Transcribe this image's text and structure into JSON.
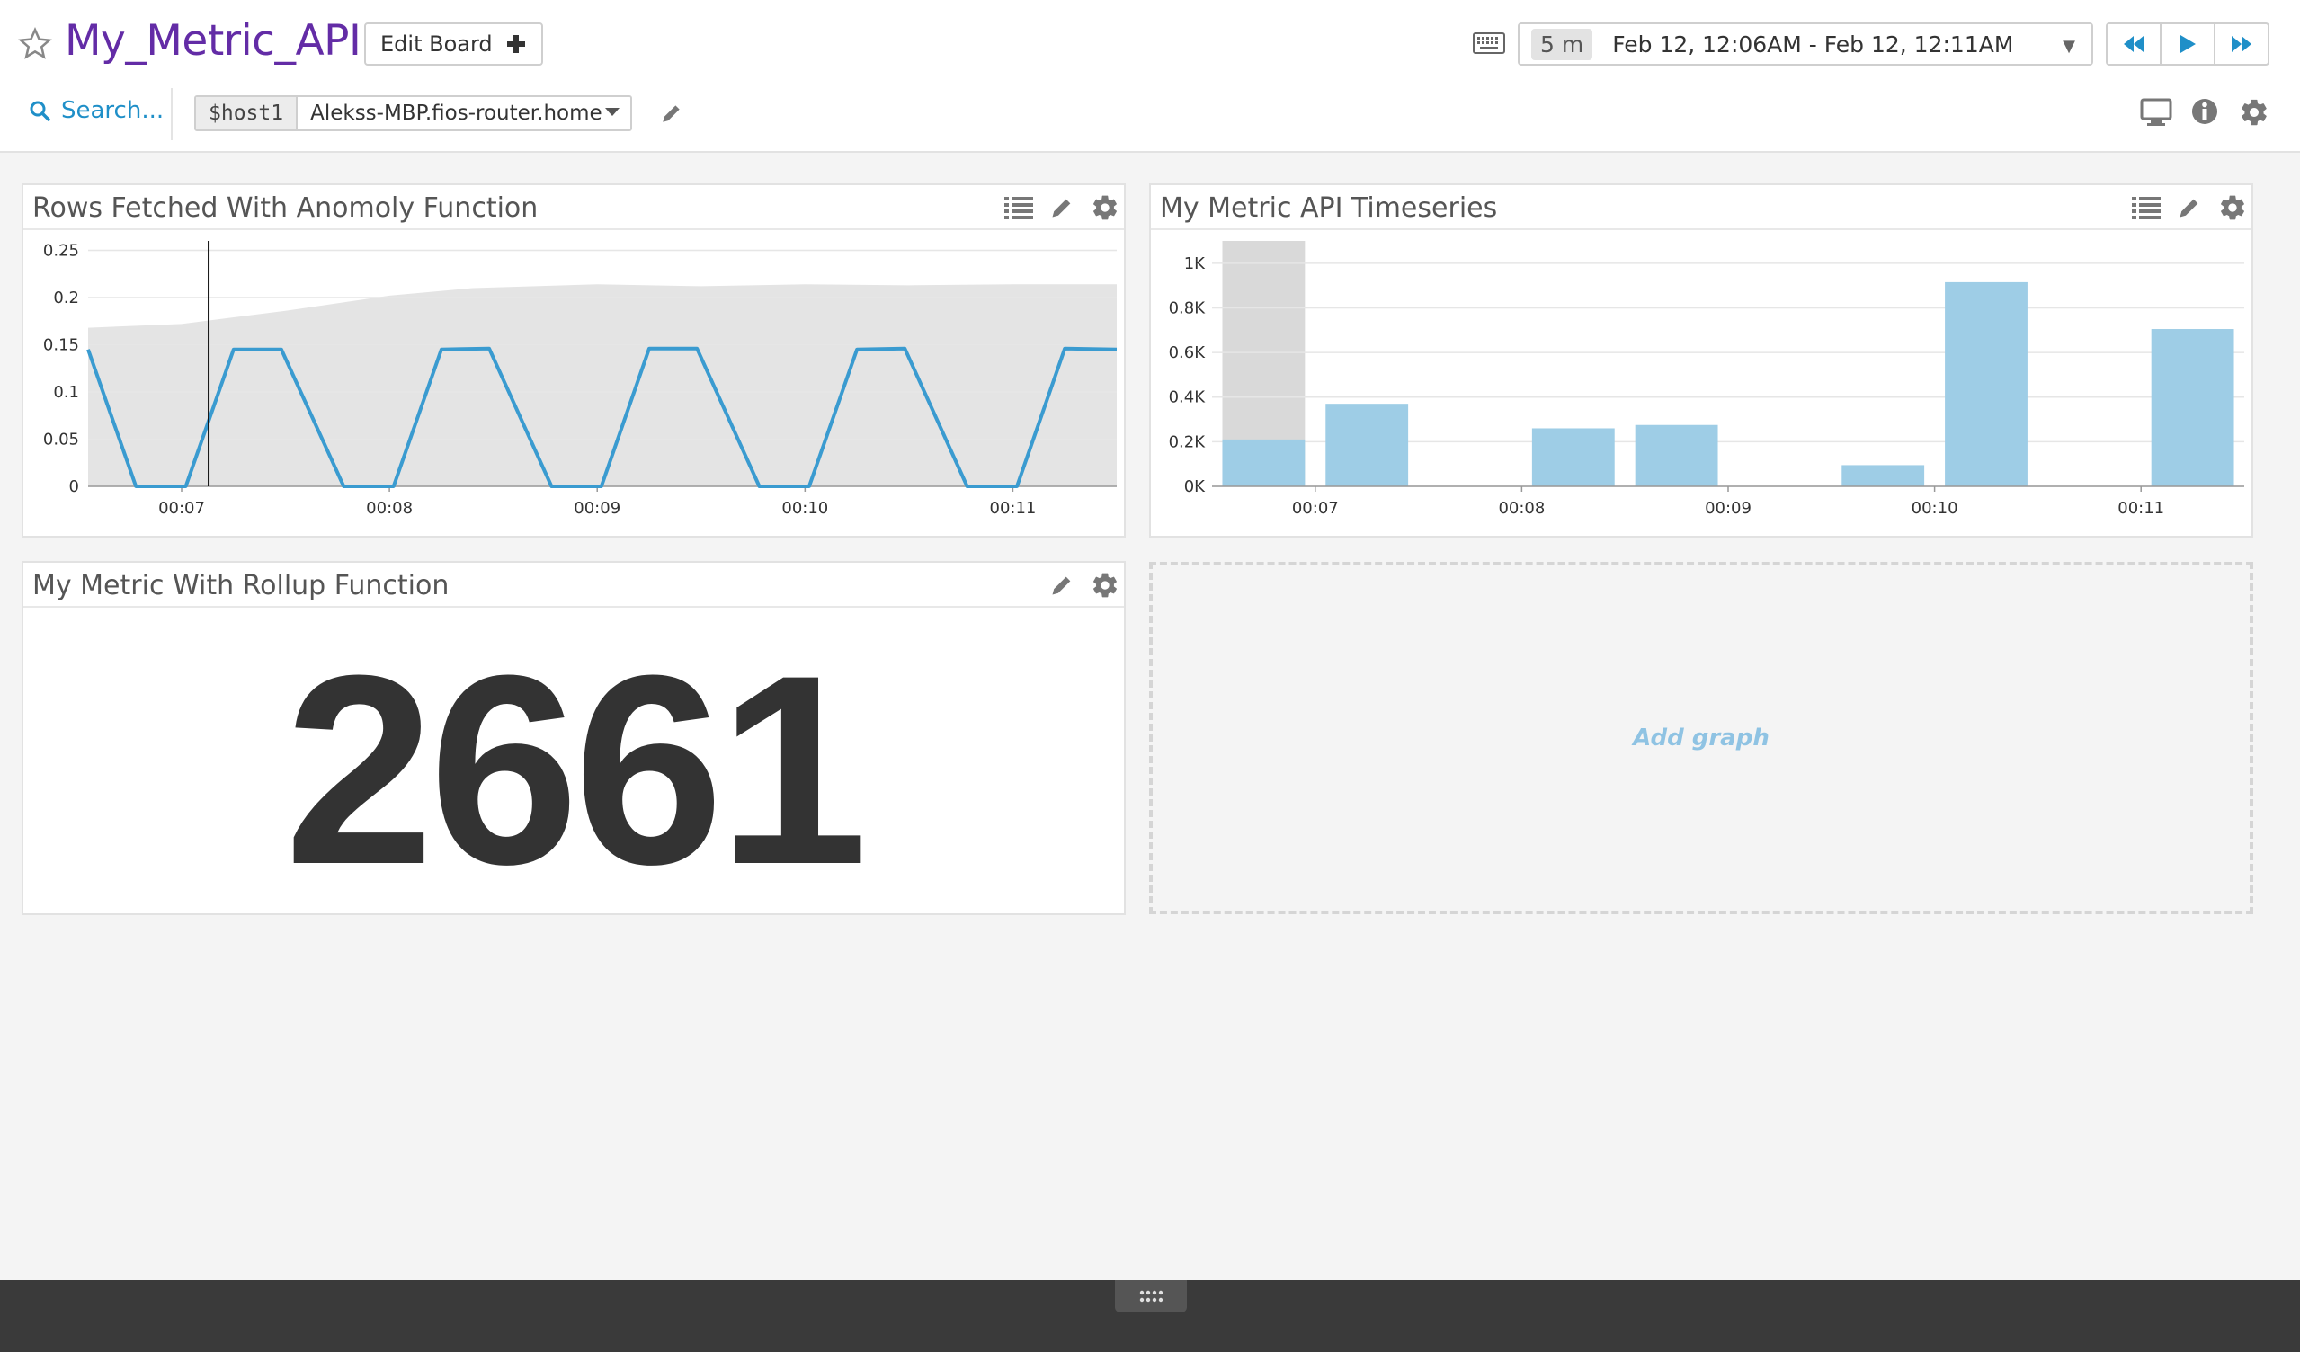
{
  "header": {
    "title": "My_Metric_API",
    "edit_board_label": "Edit Board",
    "time_chip": "5 m",
    "time_range": "Feb 12, 12:06AM - Feb 12, 12:11AM"
  },
  "toolbar": {
    "search_label": "Search...",
    "template_var_name": "$host1",
    "template_var_value": "Alekss-MBP.fios-router.home"
  },
  "widgets": {
    "anomaly": {
      "title": "Rows Fetched With Anomoly Function"
    },
    "timeseries": {
      "title": "My Metric API Timeseries"
    },
    "rollup": {
      "title": "My Metric With Rollup Function",
      "value": "2661"
    },
    "add_graph_label": "Add graph"
  },
  "colors": {
    "accent": "#632ca6",
    "link": "#1f8fc8",
    "line_series": "#3a9bd0",
    "bar_series": "#9ecde6",
    "anomaly_band": "#e4e4e4"
  },
  "chart_data": [
    {
      "type": "line",
      "title": "Rows Fetched With Anomoly Function",
      "x_ticks": [
        "00:07",
        "00:08",
        "00:09",
        "00:10",
        "00:11"
      ],
      "y_ticks": [
        "0",
        "0.05",
        "0.1",
        "0.15",
        "0.2",
        "0.25"
      ],
      "ylim": [
        0,
        0.26
      ],
      "x_domain_minutes": [
        6.55,
        11.5
      ],
      "series": [
        {
          "x": [
            6.55,
            6.78,
            7.02,
            7.25,
            7.48,
            7.78,
            8.02,
            8.25,
            8.48,
            8.78,
            9.02,
            9.25,
            9.48,
            9.78,
            10.02,
            10.25,
            10.48,
            10.78,
            11.02,
            11.25,
            11.5
          ],
          "values": [
            0.145,
            0,
            0,
            0.145,
            0.145,
            0,
            0,
            0.145,
            0.146,
            0,
            0,
            0.146,
            0.146,
            0,
            0,
            0.145,
            0.146,
            0,
            0,
            0.146,
            0.145
          ]
        }
      ],
      "anomaly_band": {
        "x": [
          6.55,
          7.0,
          7.5,
          8.0,
          8.4,
          9.0,
          9.5,
          10.0,
          10.5,
          11.0,
          11.5
        ],
        "upper": [
          0.168,
          0.172,
          0.186,
          0.202,
          0.21,
          0.214,
          0.212,
          0.214,
          0.213,
          0.214,
          0.214
        ]
      },
      "cursor_x": 7.13,
      "grid": true
    },
    {
      "type": "bar",
      "title": "My Metric API Timeseries",
      "x_ticks": [
        "00:07",
        "00:08",
        "00:09",
        "00:10",
        "00:11"
      ],
      "y_ticks": [
        "0K",
        "0.2K",
        "0.4K",
        "0.6K",
        "0.8K",
        "1K"
      ],
      "ylim": [
        0,
        1100
      ],
      "x_domain_minutes": [
        6.5,
        11.5
      ],
      "bars": [
        {
          "x": 6.75,
          "value": 210
        },
        {
          "x": 7.25,
          "value": 370
        },
        {
          "x": 8.25,
          "value": 260
        },
        {
          "x": 8.75,
          "value": 275
        },
        {
          "x": 9.75,
          "value": 95
        },
        {
          "x": 10.25,
          "value": 915
        },
        {
          "x": 11.25,
          "value": 705
        }
      ],
      "incomplete_bar": {
        "x": 6.75,
        "value": 1100
      },
      "grid": true
    }
  ]
}
